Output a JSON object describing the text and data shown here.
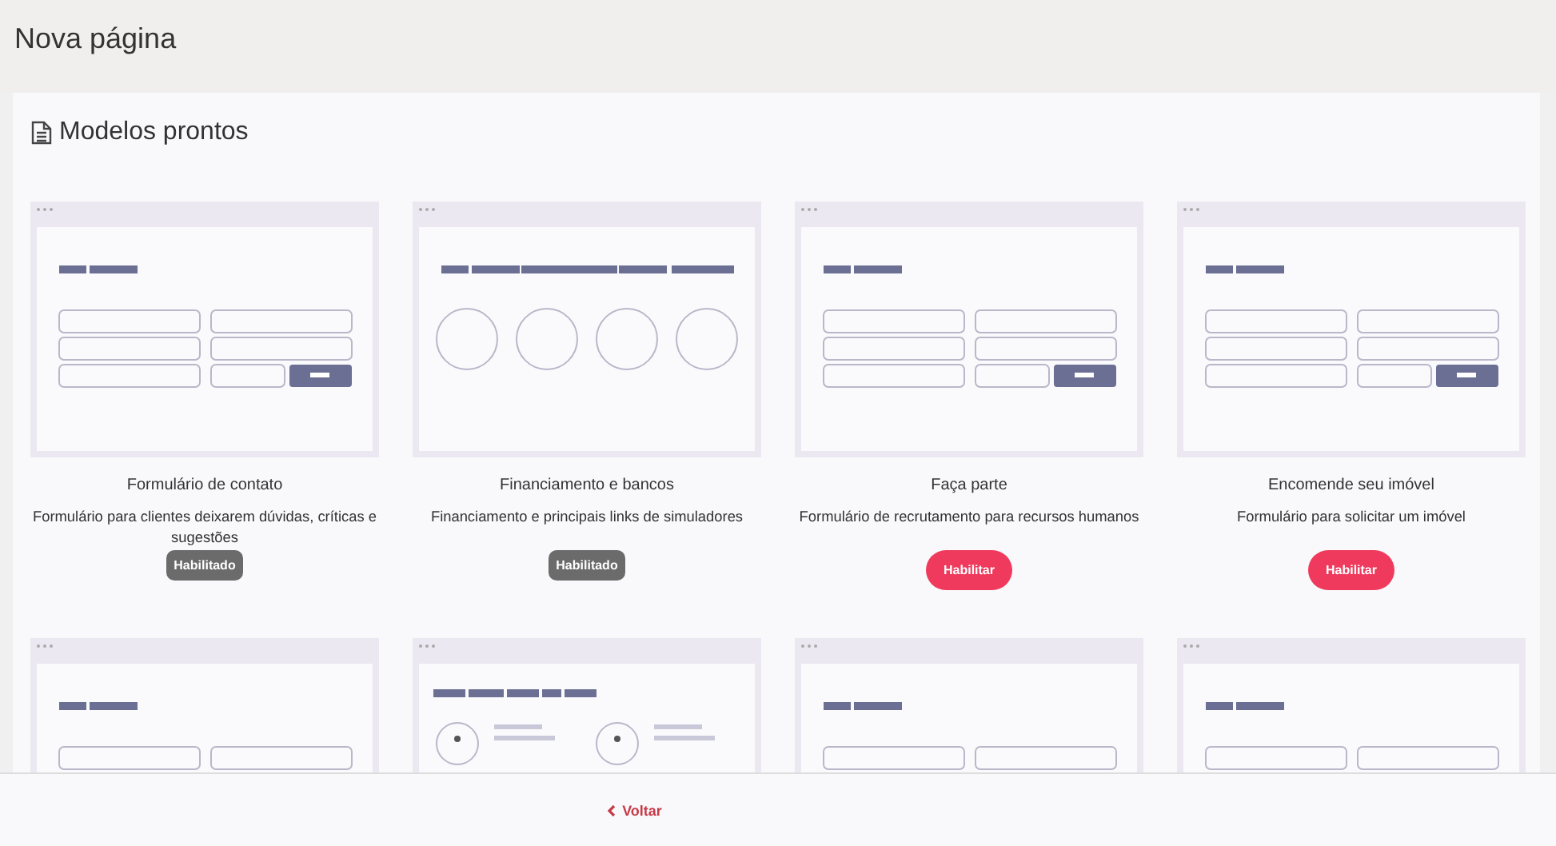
{
  "page_title": "Nova página",
  "section": {
    "title": "Modelos prontos"
  },
  "templates": [
    {
      "kind": "form",
      "title": "Formulário de contato",
      "description": "Formulário para clientes deixarem dúvidas, críticas e sugestões",
      "action": {
        "label": "Habilitado",
        "enabled": true
      }
    },
    {
      "kind": "circles",
      "title": "Financiamento e bancos",
      "description": "Financiamento e principais links de simuladores",
      "action": {
        "label": "Habilitado",
        "enabled": true
      }
    },
    {
      "kind": "form",
      "title": "Faça parte",
      "description": "Formulário de recrutamento para recursos humanos",
      "action": {
        "label": "Habilitar",
        "enabled": false
      }
    },
    {
      "kind": "form",
      "title": "Encomende seu imóvel",
      "description": "Formulário para solicitar um imóvel",
      "action": {
        "label": "Habilitar",
        "enabled": false
      }
    },
    {
      "kind": "form"
    },
    {
      "kind": "profiles"
    },
    {
      "kind": "form"
    },
    {
      "kind": "form"
    }
  ],
  "footer": {
    "back_link": "Voltar"
  }
}
